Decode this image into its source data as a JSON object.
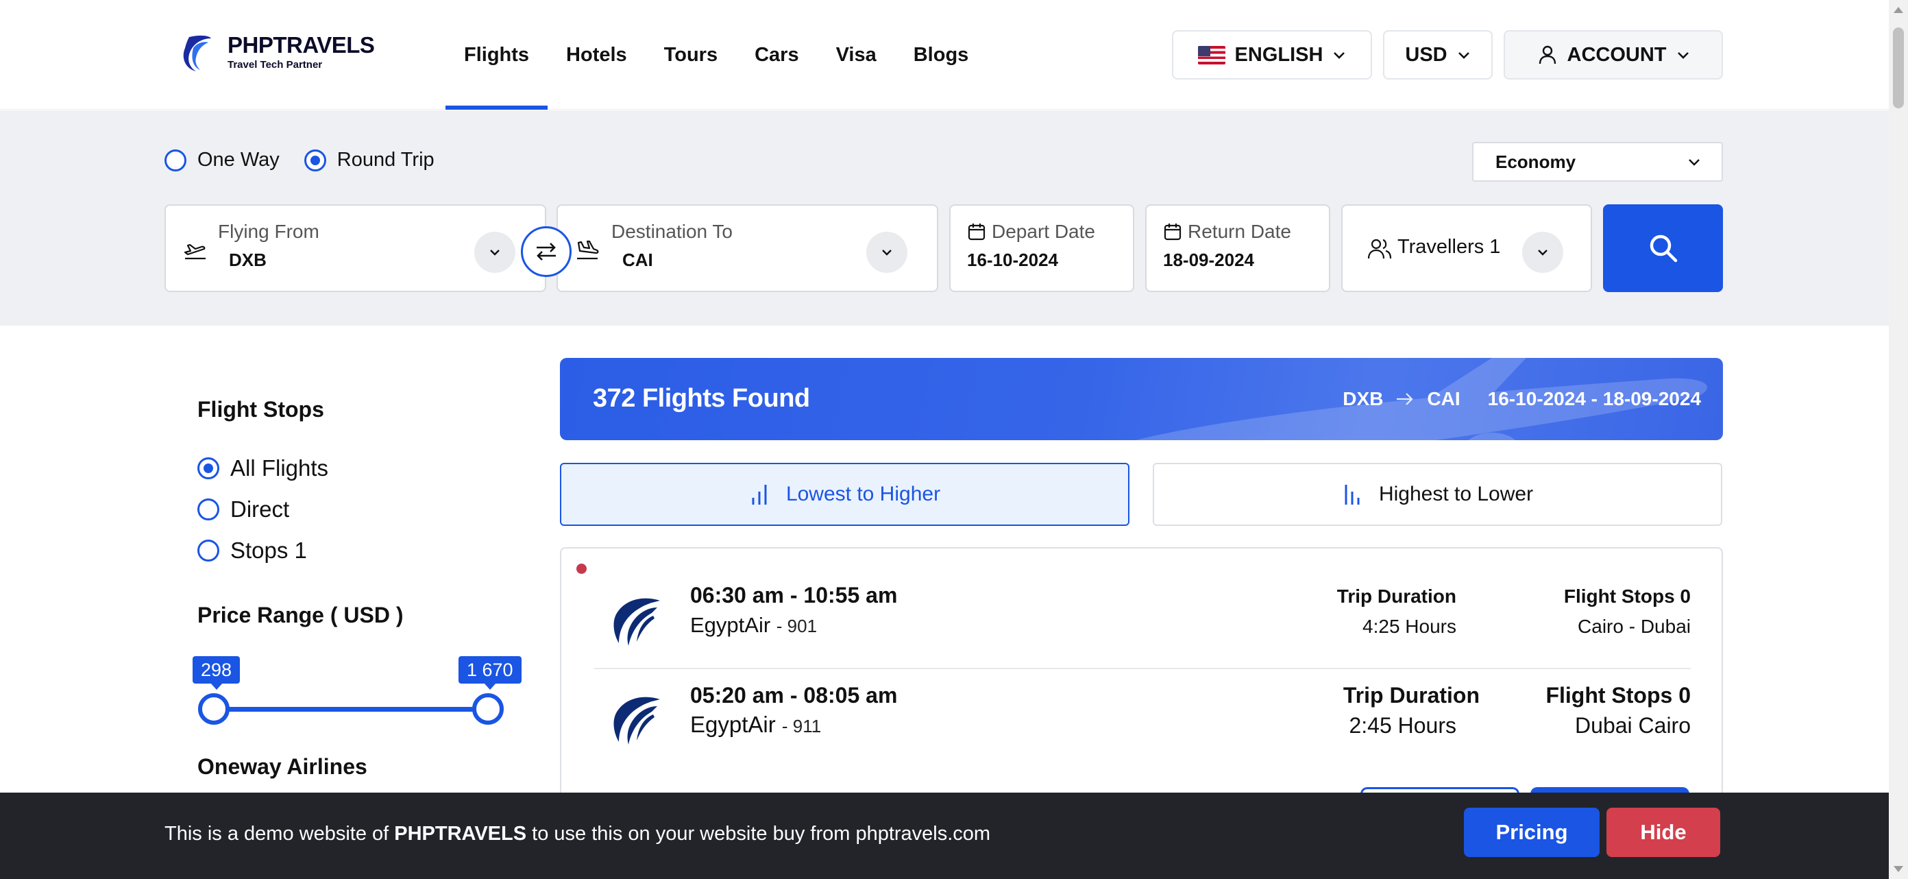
{
  "header": {
    "brand": {
      "title": "PHPTRAVELS",
      "subtitle": "Travel Tech Partner"
    },
    "nav": [
      "Flights",
      "Hotels",
      "Tours",
      "Cars",
      "Visa",
      "Blogs"
    ],
    "active_nav": "Flights",
    "language": "ENGLISH",
    "currency": "USD",
    "account": "ACCOUNT"
  },
  "search": {
    "trip_types": {
      "one_way": "One Way",
      "round_trip": "Round Trip"
    },
    "selected_trip": "Round Trip",
    "cabin": "Economy",
    "from": {
      "label": "Flying From",
      "value": "DXB"
    },
    "to": {
      "label": "Destination To",
      "value": "CAI"
    },
    "depart": {
      "label": "Depart Date",
      "value": "16-10-2024"
    },
    "return": {
      "label": "Return Date",
      "value": "18-09-2024"
    },
    "travellers": "Travellers 1"
  },
  "filters": {
    "stops_title": "Flight Stops",
    "stops_options": [
      "All Flights",
      "Direct",
      "Stops 1"
    ],
    "selected_stop": "All Flights",
    "price_title": "Price Range ( USD )",
    "price_min": "298",
    "price_max": "1 670",
    "airlines_title": "Oneway Airlines"
  },
  "results": {
    "count_text": "372 Flights Found",
    "route_from": "DXB",
    "route_to": "CAI",
    "route_dates": "16-10-2024 - 18-09-2024",
    "sort_low": "Lowest to Higher",
    "sort_high": "Highest to Lower",
    "flight": {
      "outbound": {
        "time": "06:30 am - 10:55 am",
        "airline": "EgyptAir",
        "flight_no": "- 901",
        "duration_label": "Trip Duration",
        "duration": "4:25 Hours",
        "stops_label": "Flight Stops 0",
        "route": "Cairo - Dubai"
      },
      "inbound": {
        "time": "05:20 am - 08:05 am",
        "airline": "EgyptAir",
        "flight_no": "- 911",
        "duration_label": "Trip Duration",
        "duration": "2:45 Hours",
        "stops_label": "Flight Stops 0",
        "route": "Dubai Cairo"
      }
    }
  },
  "demo_bar": {
    "text_prefix": "This is a demo website of",
    "brand": "PHPTRAVELS",
    "text_suffix": "to use this on your website buy from phptravels.com",
    "pricing": "Pricing",
    "hide": "Hide"
  },
  "colors": {
    "primary": "#1a55e3",
    "danger": "#d33f4d",
    "demo_bar": "#222429",
    "band": "#eff0f3"
  }
}
